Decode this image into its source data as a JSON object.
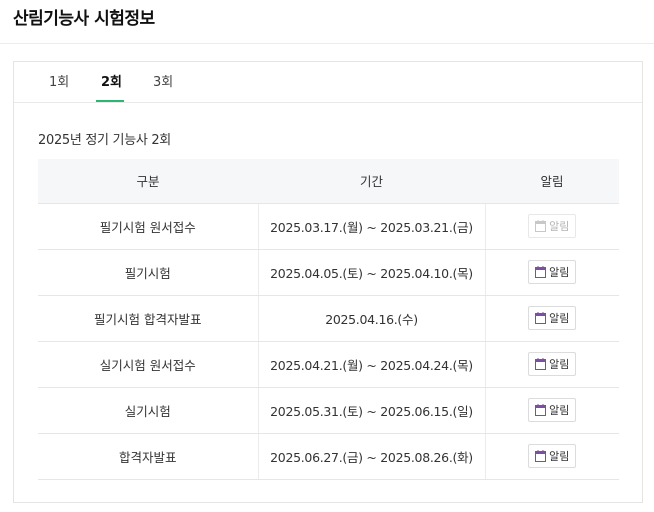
{
  "page": {
    "title": "산림기능사 시험정보"
  },
  "tabs": [
    {
      "label": "1회",
      "active": false
    },
    {
      "label": "2회",
      "active": true
    },
    {
      "label": "3회",
      "active": false
    }
  ],
  "round_title": "2025년 정기 기능사 2회",
  "table": {
    "headers": {
      "type": "구분",
      "period": "기간",
      "alarm": "알림"
    },
    "rows": [
      {
        "type": "필기시험 원서접수",
        "period": "2025.03.17.(월) ~ 2025.03.21.(금)",
        "alarm": "알림",
        "alarm_enabled": false
      },
      {
        "type": "필기시험",
        "period": "2025.04.05.(토) ~ 2025.04.10.(목)",
        "alarm": "알림",
        "alarm_enabled": true
      },
      {
        "type": "필기시험 합격자발표",
        "period": "2025.04.16.(수)",
        "alarm": "알림",
        "alarm_enabled": true
      },
      {
        "type": "실기시험 원서접수",
        "period": "2025.04.21.(월) ~ 2025.04.24.(목)",
        "alarm": "알림",
        "alarm_enabled": true
      },
      {
        "type": "실기시험",
        "period": "2025.05.31.(토) ~ 2025.06.15.(일)",
        "alarm": "알림",
        "alarm_enabled": true
      },
      {
        "type": "합격자발표",
        "period": "2025.06.27.(금) ~ 2025.08.26.(화)",
        "alarm": "알림",
        "alarm_enabled": true
      }
    ]
  },
  "colors": {
    "accent": "#2bb673",
    "calendar_icon": "#7b4fa6",
    "calendar_icon_disabled": "#c8c8c8"
  },
  "icons": {
    "alarm": "calendar-icon"
  }
}
